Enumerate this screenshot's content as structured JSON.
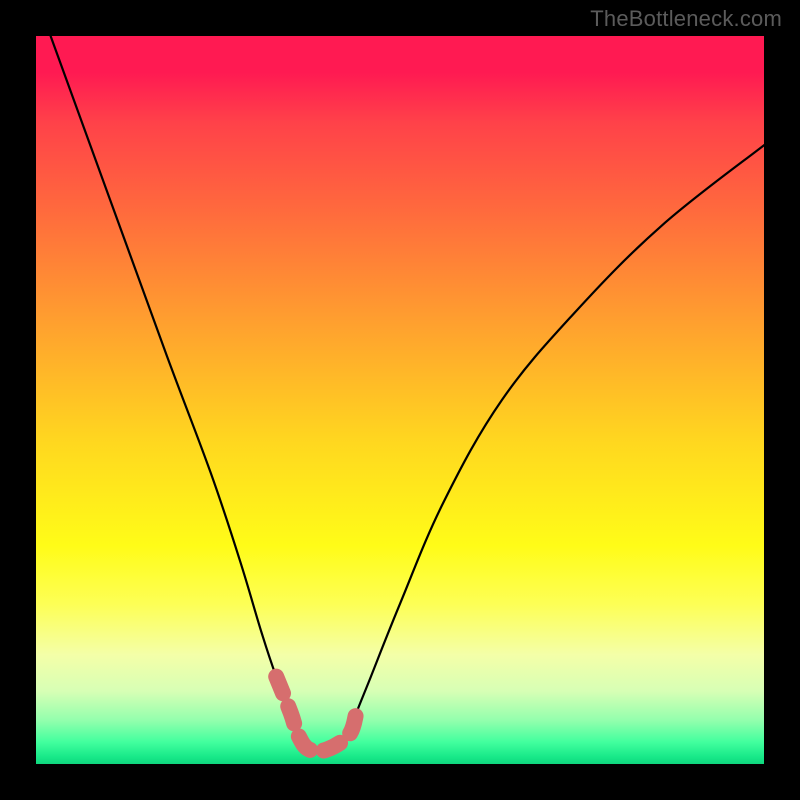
{
  "watermark": "TheBottleneck.com",
  "chart_data": {
    "type": "line",
    "title": "",
    "xlabel": "",
    "ylabel": "",
    "xlim": [
      0,
      100
    ],
    "ylim": [
      0,
      100
    ],
    "series": [
      {
        "name": "bottleneck-curve",
        "x": [
          2,
          10,
          18,
          24,
          28,
          31,
          33,
          35,
          36,
          37.5,
          40,
          43,
          44,
          46,
          50,
          56,
          64,
          74,
          86,
          100
        ],
        "values": [
          100,
          78,
          56,
          40,
          28,
          18,
          12,
          7,
          4,
          2,
          2,
          4,
          7,
          12,
          22,
          36,
          50,
          62,
          74,
          85
        ]
      },
      {
        "name": "highlight-segment",
        "x": [
          33,
          35,
          36,
          37.5,
          40,
          43,
          44
        ],
        "values": [
          12,
          7,
          4,
          2,
          2,
          4,
          7
        ]
      }
    ],
    "gradient_stops": [
      {
        "pct": 0,
        "color": "#ff1a52"
      },
      {
        "pct": 70,
        "color": "#fffc18"
      },
      {
        "pct": 100,
        "color": "#0fd77e"
      }
    ]
  }
}
